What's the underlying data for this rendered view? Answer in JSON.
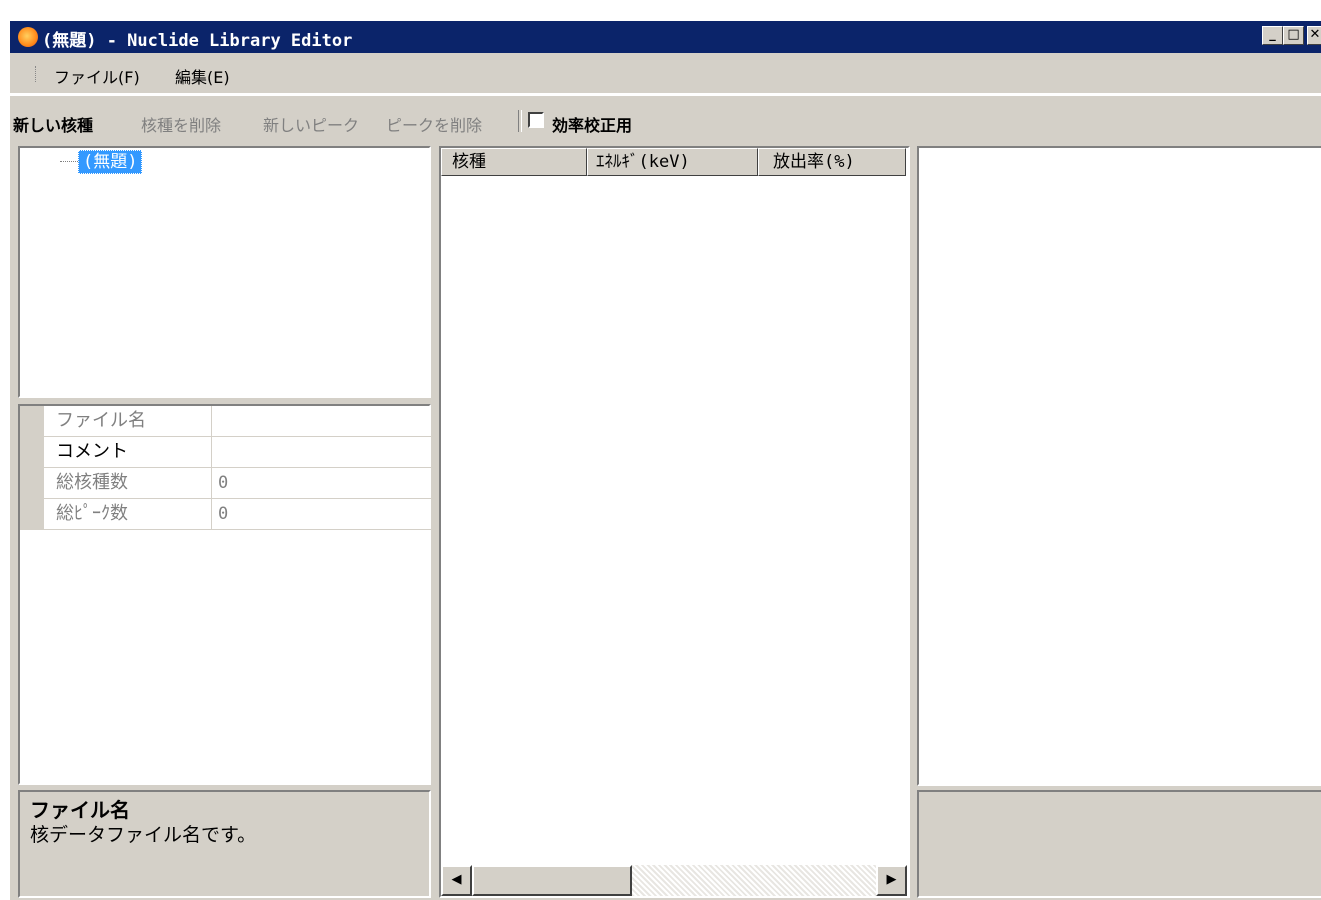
{
  "window": {
    "title": "(無題) - Nuclide Library Editor",
    "controls": {
      "minimize": "_",
      "maximize": "□",
      "close": "✕"
    }
  },
  "menu": {
    "items": [
      "ファイル(F)",
      "編集(E)"
    ]
  },
  "toolbar": {
    "new_nuclide": "新しい核種",
    "delete_nuclide": "核種を削除",
    "new_peak": "新しいピーク",
    "delete_peak": "ピークを削除",
    "efficiency_calibration": "効率校正用",
    "efficiency_calibration_checked": false
  },
  "tree": {
    "root_label": "(無題)"
  },
  "properties": {
    "rows": [
      {
        "name": "ファイル名",
        "value": ""
      },
      {
        "name": "コメント",
        "value": ""
      },
      {
        "name": "総核種数",
        "value": "0"
      },
      {
        "name": "総ﾋﾟｰｸ数",
        "value": "0"
      }
    ]
  },
  "description": {
    "title": "ファイル名",
    "text": "核データファイル名です。"
  },
  "peak_list": {
    "columns": [
      "核種",
      "ｴﾈﾙｷﾞ(keV)",
      "放出率(%)"
    ],
    "rows": []
  },
  "colors": {
    "titlebar": "#0b246a",
    "face": "#d4d0c8",
    "selection": "#3399ff"
  },
  "icons": {
    "app": "radiation-app-icon",
    "scroll_left": "scroll-left-arrow-icon",
    "scroll_right": "scroll-right-arrow-icon"
  }
}
